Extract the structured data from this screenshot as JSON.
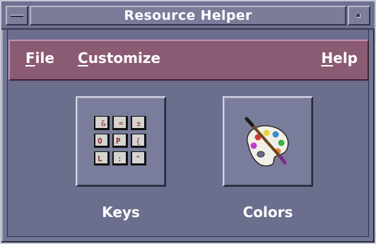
{
  "window": {
    "title": "Resource Helper"
  },
  "menubar": {
    "file": {
      "mnemonic": "F",
      "rest": "ile"
    },
    "customize": {
      "mnemonic": "C",
      "rest": "ustomize"
    },
    "help": {
      "mnemonic": "H",
      "rest": "elp"
    }
  },
  "tools": [
    {
      "label": "Keys",
      "icon": "keyboard-keys-icon"
    },
    {
      "label": "Colors",
      "icon": "paint-palette-icon"
    }
  ],
  "colors": {
    "menubar": "#8b5b73",
    "window": "#737595",
    "text": "#ffffff"
  }
}
